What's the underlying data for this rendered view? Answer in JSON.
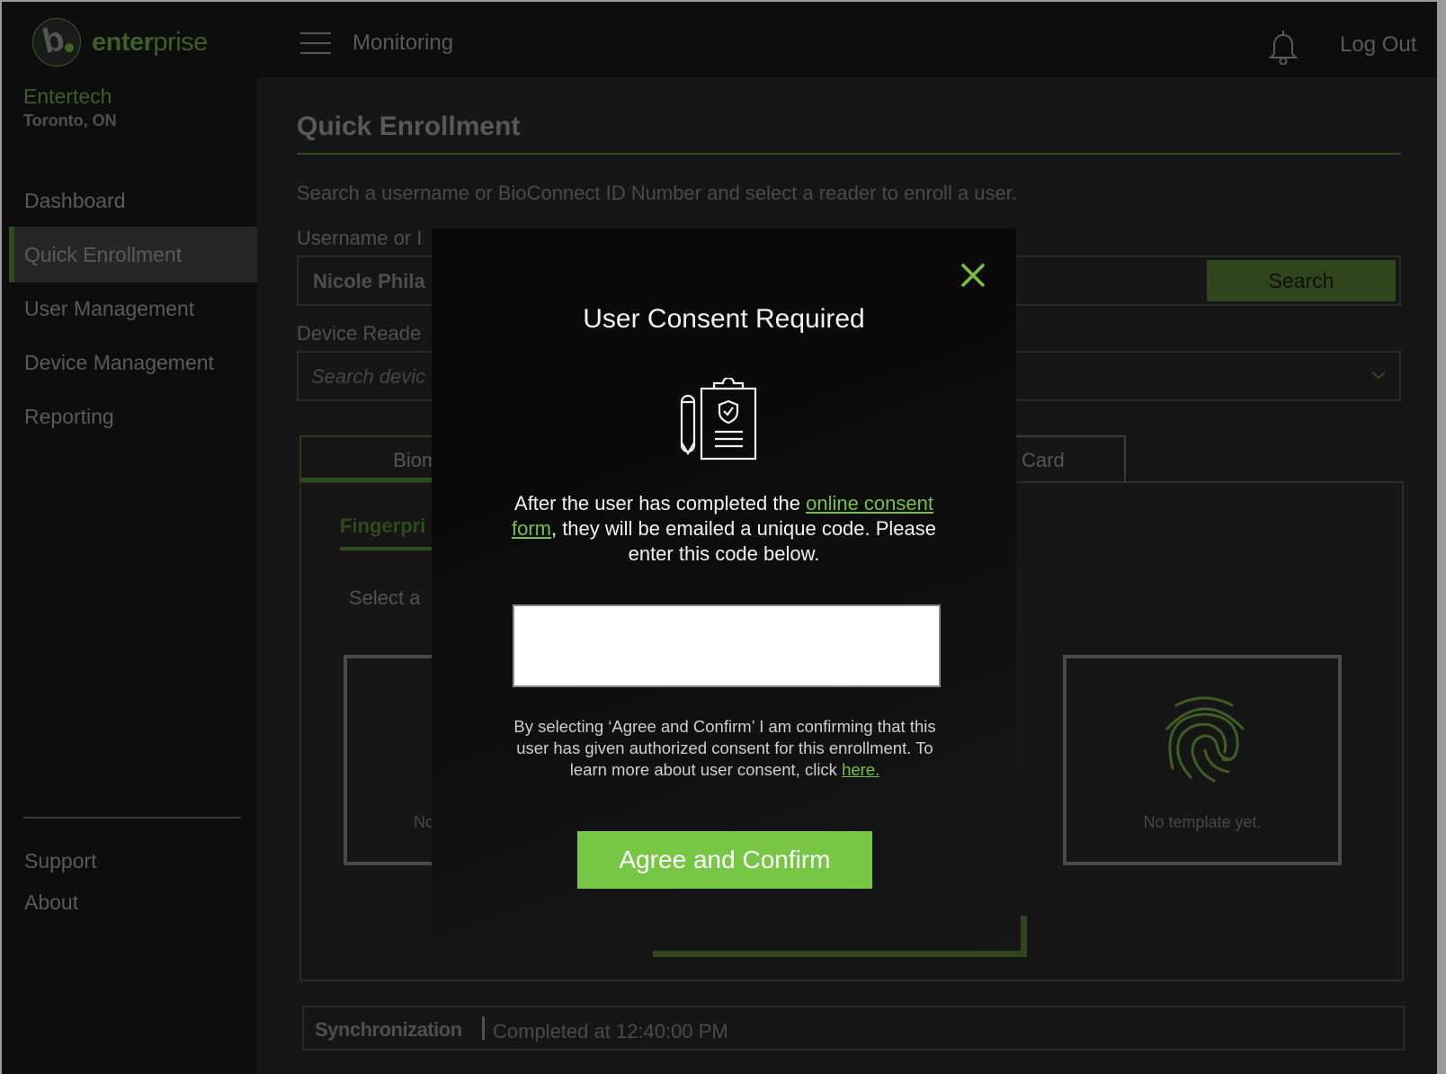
{
  "header": {
    "logo_brand_bold": "enter",
    "logo_brand_light": "prise",
    "menu_label": "Monitoring",
    "logout_label": "Log Out"
  },
  "sidebar": {
    "org_name": "Entertech",
    "org_location": "Toronto, ON",
    "items": [
      {
        "label": "Dashboard",
        "active": false
      },
      {
        "label": "Quick Enrollment",
        "active": true
      },
      {
        "label": "User Management",
        "active": false
      },
      {
        "label": "Device Management",
        "active": false
      },
      {
        "label": "Reporting",
        "active": false
      }
    ],
    "footer_items": [
      {
        "label": "Support"
      },
      {
        "label": "About"
      }
    ]
  },
  "main": {
    "title": "Quick Enrollment",
    "subtitle": "Search a username or BioConnect ID Number and select a reader to enroll a user.",
    "username_label": "Username or I",
    "username_value": "Nicole Phila",
    "search_button": "Search",
    "device_label": "Device Reade",
    "device_placeholder": "Search devic",
    "tabs": [
      {
        "label": "Biometric",
        "active": true
      },
      {
        "label": "Card",
        "active": false
      }
    ],
    "subtab": "Fingerpri",
    "select_prompt": "Select a",
    "template_left_text": "No",
    "template_right_text": "No template yet.",
    "sync_label": "Synchronization",
    "sync_value": "Completed at 12:40:00 PM"
  },
  "modal": {
    "title": "User Consent Required",
    "body_prefix": "After the user has completed the ",
    "body_link": "online consent form",
    "body_suffix": ", they will be emailed a unique code. Please enter this code below.",
    "code_value": "",
    "fine_print": "By selecting ‘Agree and Confirm’ I am confirming that this user has given authorized consent for this enrollment. To learn more about user consent, click ",
    "fine_link": "here.",
    "agree_button": "Agree and Confirm"
  },
  "colors": {
    "accent": "#77c745",
    "accent_dim": "#2f4a1c",
    "background": "#161616",
    "sidebar": "#0d0d0d"
  }
}
